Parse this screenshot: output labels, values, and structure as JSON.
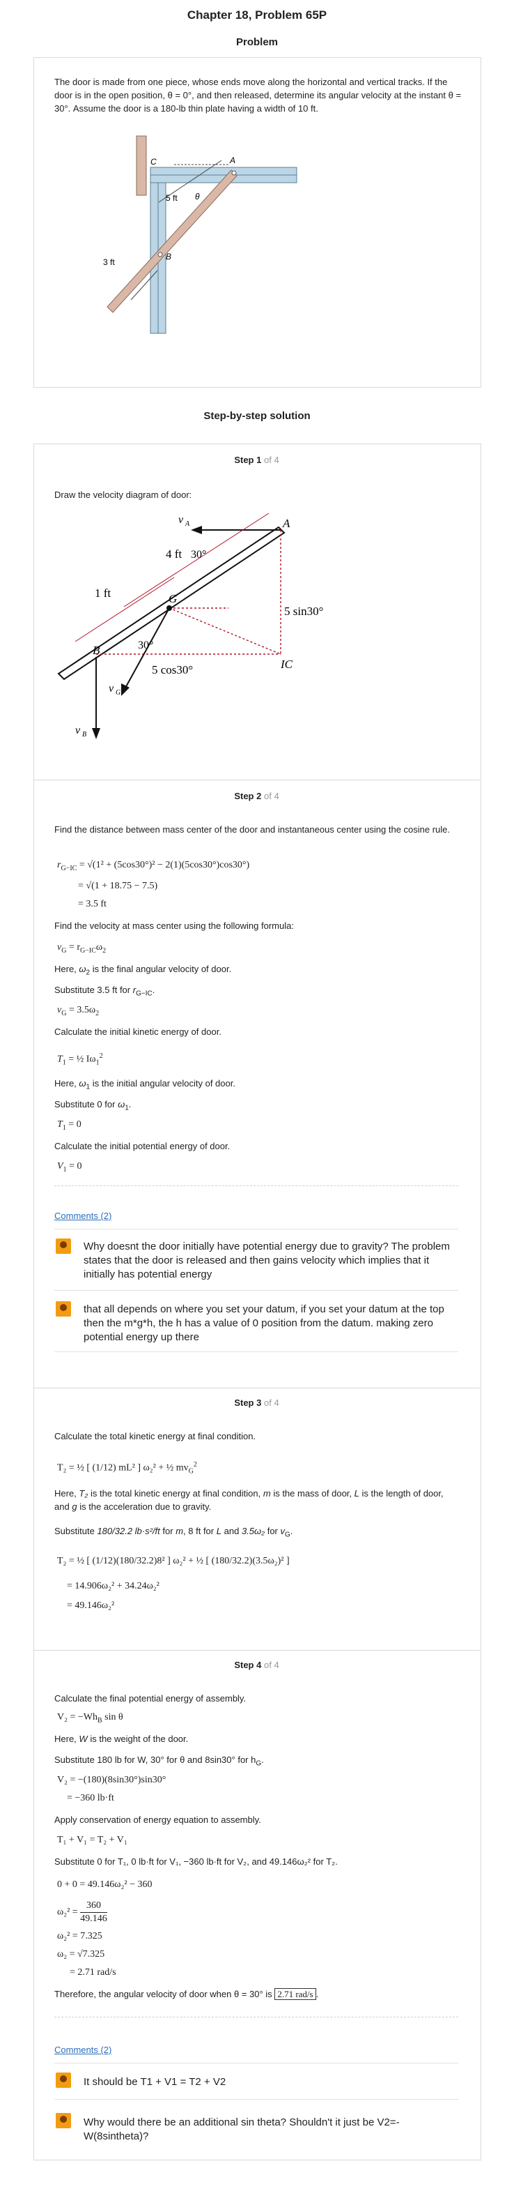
{
  "header": {
    "title": "Chapter 18, Problem 65P",
    "problem_label": "Problem"
  },
  "problem": {
    "text": "The door is made from one piece, whose ends move along the horizontal and vertical tracks. If the door is in the open position, θ = 0°, and then released, determine its angular velocity at the instant θ = 30°. Assume the door is a 180-lb thin plate having a width of 10 ft.",
    "figure": {
      "label_c": "C",
      "label_a": "A",
      "label_b": "B",
      "label_theta": "θ",
      "label_5ft": "5 ft",
      "label_3ft": "3 ft"
    }
  },
  "solution": {
    "title": "Step-by-step solution",
    "step_word": "Step",
    "of_word": "of 4",
    "steps": [
      {
        "num": "1"
      },
      {
        "num": "2"
      },
      {
        "num": "3"
      },
      {
        "num": "4"
      }
    ]
  },
  "step1": {
    "intro": "Draw the velocity diagram of door:",
    "diagram": {
      "vA": "v",
      "vA_sub": "A",
      "A": "A",
      "four_ft": "4 ft",
      "thirty_top": "30°",
      "one_ft": "1 ft",
      "G": "G",
      "five_sin": "5 sin30°",
      "thirty_mid": "30°",
      "B": "B",
      "five_cos": "5 cos30°",
      "IC": "IC",
      "vG": "v",
      "vG_sub": "G",
      "vB": "v",
      "vB_sub": "B"
    }
  },
  "step2": {
    "t1": "Find the distance between mass center of the door and instantaneous center using the cosine rule.",
    "eq1": "r",
    "eq1_sub": "G−IC",
    "eq1_rhs": "= √(1² + (5cos30°)² − 2(1)(5cos30°)cos30°)",
    "eq2": "= √(1 + 18.75 − 7.5)",
    "eq3": "= 3.5 ft",
    "t2": "Find the velocity at mass center using the following formula:",
    "eq4": "v",
    "eq4_sub": "G",
    "eq4_rhs": "= r",
    "eq4_rsub": "G−IC",
    "eq4_tail": "ω",
    "eq4_tail_sub": "2",
    "t3a": "Here,",
    "t3b": "ω",
    "t3c": "2",
    "t3d": "is the final angular velocity of door.",
    "t4": "Substitute 3.5 ft for",
    "t4b": "r",
    "t4c": "G−IC",
    "t4d": ".",
    "eq5": "v",
    "eq5_sub": "G",
    "eq5_rhs": "= 3.5ω",
    "eq5_rsub": "2",
    "t5": "Calculate the initial kinetic energy of door.",
    "eq6_lhs": "T",
    "eq6_sub": "1",
    "eq6_rhs": "= ½ Iω",
    "eq6_rsub": "1",
    "eq6_sup": "2",
    "t6a": "Here,",
    "t6b": "ω",
    "t6c": "1",
    "t6d": "is the initial angular velocity of door.",
    "t7": "Substitute 0 for",
    "t7b": "ω",
    "t7c": "1",
    "t7d": ".",
    "eq7": "T",
    "eq7_sub": "1",
    "eq7_rhs": "= 0",
    "t8": "Calculate the initial potential energy of door.",
    "eq8": "V",
    "eq8_sub": "1",
    "eq8_rhs": "= 0",
    "comments_link": "Comments (2)",
    "comments": [
      {
        "text": "Why doesnt the door initially have potential energy due to gravity? The problem states that the door is released and then gains velocity which implies that it initially has potential energy"
      },
      {
        "text": "that all depends on where you set your datum, if you set your datum at the top then the m*g*h, the h has a value of 0 position from the datum. making zero potential energy up there"
      }
    ]
  },
  "step3": {
    "t1": "Calculate the total kinetic energy at final condition.",
    "eq1": "T₂ = ½ [ (1/12) mL² ] ω₂² + ½ mv",
    "eq1_sub": "G",
    "eq1_sup": "2",
    "t2a": "Here,",
    "t2b": "T₂",
    "t2c": "is the total kinetic energy at final condition,",
    "t2d": "m",
    "t2e": "is the mass of door,",
    "t2f": "L",
    "t2g": "is the length of door, and",
    "t2h": "g",
    "t2i": "is the acceleration due to gravity.",
    "t3a": "Substitute",
    "t3b": "180/32.2 lb·s²/ft",
    "t3c": "for",
    "t3d": "m",
    "t3e": ", 8 ft for",
    "t3f": "L",
    "t3g": "and",
    "t3h": "3.5ω₂",
    "t3i": "for",
    "t3j": "v",
    "t3k": "G",
    "t3l": ".",
    "eq2": "T₂ = ½ [ (1/12)(180/32.2)8² ] ω₂² + ½ [ (180/32.2)(3.5ω₂)² ]",
    "eq3": "= 14.906ω₂² + 34.24ω₂²",
    "eq4": "= 49.146ω₂²"
  },
  "step4": {
    "t1": "Calculate the final potential energy of assembly.",
    "eq1": "V₂ = −Wh",
    "eq1_sub": "B",
    "eq1_tail": "sin θ",
    "t2a": "Here,",
    "t2b": "W",
    "t2c": "is the weight of the door.",
    "t3": "Substitute 180 lb for W, 30° for θ and 8sin30° for h",
    "t3_sub": "G",
    "t3_end": ".",
    "eq2": "V₂ = −(180)(8sin30°)sin30°",
    "eq3": "= −360 lb·ft",
    "t4": "Apply conservation of energy equation to assembly.",
    "eq4": "T₁ + V₁ = T₂ + V₁",
    "t5": "Substitute 0 for T₁, 0 lb·ft for V₁, −360 lb·ft for V₂, and 49.146ω₂² for T₂.",
    "eq5": "0 + 0 = 49.146ω₂² − 360",
    "eq6a": "ω₂² =",
    "eq6n": "360",
    "eq6d": "49.146",
    "eq7": "ω₂² = 7.325",
    "eq8": "ω₂ = √7.325",
    "eq9": "= 2.71 rad/s",
    "t6": "Therefore, the angular velocity of door when θ = 30° is",
    "answer": "2.71 rad/s",
    "t6_end": ".",
    "comments_link": "Comments (2)",
    "comments": [
      {
        "text": "It should be T1 + V1 = T2 + V2"
      },
      {
        "text": "Why would there be an additional sin theta? Shouldn't it just be V2=-W(8sintheta)?"
      }
    ]
  }
}
